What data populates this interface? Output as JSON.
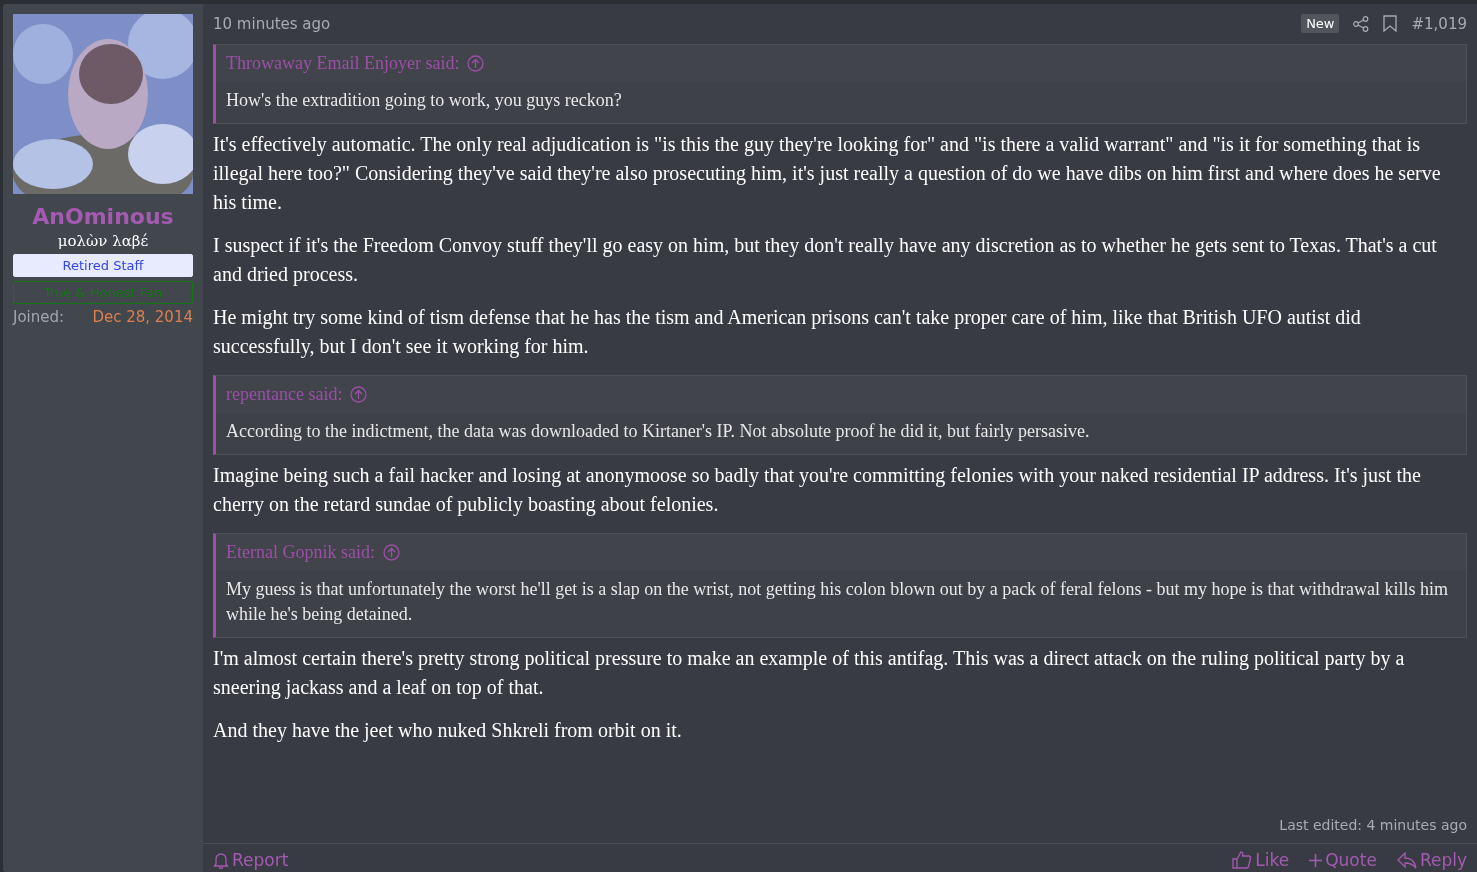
{
  "user": {
    "name": "AnOminous",
    "user_title": "μολὼν λαβέ",
    "banners": [
      {
        "label": "Retired Staff",
        "kind": "staff"
      },
      {
        "label": "True & Honest Fan",
        "kind": "fan"
      }
    ],
    "joined_label": "Joined:",
    "joined_value": "Dec 28, 2014"
  },
  "post": {
    "time": "10 minutes ago",
    "new_badge": "New",
    "number": "#1,019",
    "blocks": [
      {
        "kind": "quote",
        "author": "Throwaway Email Enjoyer said:",
        "text": "How's the extradition going to work, you guys reckon?"
      },
      {
        "kind": "text",
        "text": "It's effectively automatic. The only real adjudication is \"is this the guy they're looking for\" and \"is there a valid warrant\" and \"is it for something that is illegal here too?\" Considering they've said they're also prosecuting him, it's just really a question of do we have dibs on him first and where does he serve his time."
      },
      {
        "kind": "text",
        "text": "I suspect if it's the Freedom Convoy stuff they'll go easy on him, but they don't really have any discretion as to whether he gets sent to Texas. That's a cut and dried process."
      },
      {
        "kind": "text",
        "text": "He might try some kind of tism defense that he has the tism and American prisons can't take proper care of him, like that British UFO autist did successfully, but I don't see it working for him."
      },
      {
        "kind": "quote",
        "author": "repentance said:",
        "text": "According to the indictment, the data was downloaded to Kirtaner's IP. Not absolute proof he did it, but fairly persasive."
      },
      {
        "kind": "text",
        "text": "Imagine being such a fail hacker and losing at anonymoose so badly that you're committing felonies with your naked residential IP address. It's just the cherry on the retard sundae of publicly boasting about felonies."
      },
      {
        "kind": "quote",
        "author": "Eternal Gopnik said:",
        "text": "My guess is that unfortunately the worst he'll get is a slap on the wrist, not getting his colon blown out by a pack of feral felons - but my hope is that withdrawal kills him while he's being detained."
      },
      {
        "kind": "text",
        "text": "I'm almost certain there's pretty strong political pressure to make an example of this antifag. This was a direct attack on the ruling political party by a sneering jackass and a leaf on top of that."
      },
      {
        "kind": "text",
        "text": "And they have the jeet who nuked Shkreli from orbit on it."
      }
    ],
    "last_edited": "Last edited: 4 minutes ago",
    "actions_left": [
      {
        "kind": "report",
        "label": "Report"
      }
    ],
    "actions_right": [
      {
        "kind": "like",
        "label": "Like"
      },
      {
        "kind": "quote",
        "label": "Quote"
      },
      {
        "kind": "reply",
        "label": "Reply"
      }
    ]
  }
}
